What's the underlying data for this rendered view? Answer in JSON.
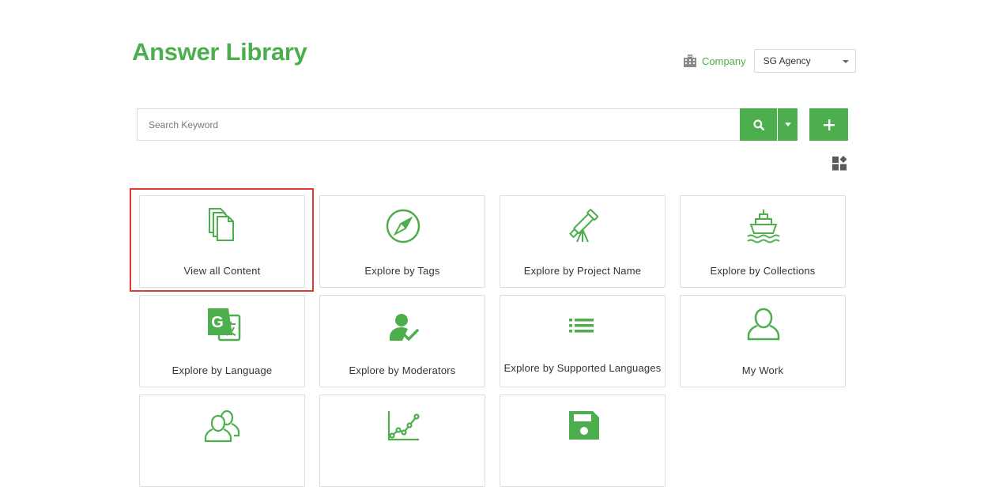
{
  "header": {
    "title": "Answer Library",
    "company_label": "Company",
    "company_value": "SG Agency"
  },
  "search": {
    "placeholder": "Search Keyword",
    "value": ""
  },
  "colors": {
    "accent": "#4cae4c",
    "highlight": "#e53935"
  },
  "tiles": [
    {
      "label": "View all Content",
      "icon": "documents-icon"
    },
    {
      "label": "Explore by Tags",
      "icon": "compass-icon"
    },
    {
      "label": "Explore by Project Name",
      "icon": "telescope-icon"
    },
    {
      "label": "Explore by Collections",
      "icon": "ship-icon"
    },
    {
      "label": "Explore by Language",
      "icon": "translate-icon"
    },
    {
      "label": "Explore by Moderators",
      "icon": "user-check-icon"
    },
    {
      "label": "Explore by Supported Languages",
      "icon": "list-icon"
    },
    {
      "label": "My Work",
      "icon": "user-icon"
    },
    {
      "label": "",
      "icon": "users-icon"
    },
    {
      "label": "",
      "icon": "line-chart-icon"
    },
    {
      "label": "",
      "icon": "save-icon"
    }
  ]
}
